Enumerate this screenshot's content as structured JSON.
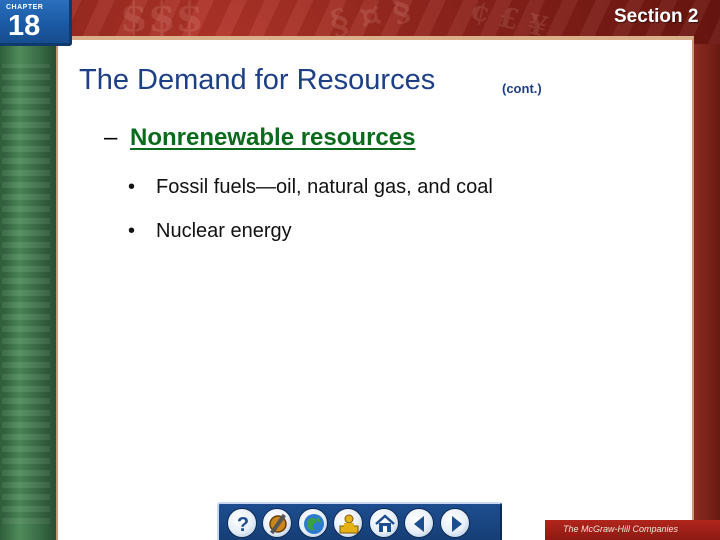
{
  "header": {
    "chapter_label": "CHAPTER",
    "chapter_number": "18",
    "section_label": "Section 2"
  },
  "slide": {
    "title": "The Demand for Resources",
    "title_suffix": "(cont.)",
    "subheading_dash": "–",
    "subheading": "Nonrenewable resources",
    "bullets": [
      "Fossil fuels—oil, natural gas, and coal",
      "Nuclear energy"
    ],
    "bullet_symbol": "•"
  },
  "nav": {
    "buttons": [
      {
        "name": "help-button",
        "icon": "question-icon"
      },
      {
        "name": "resources-button",
        "icon": "tools-icon"
      },
      {
        "name": "web-button",
        "icon": "globe-icon"
      },
      {
        "name": "presentation-button",
        "icon": "presenter-icon"
      },
      {
        "name": "home-button",
        "icon": "home-icon"
      },
      {
        "name": "previous-button",
        "icon": "arrow-left-icon"
      },
      {
        "name": "next-button",
        "icon": "arrow-right-icon"
      }
    ]
  },
  "footer": {
    "publisher": "The McGraw-Hill Companies"
  },
  "colors": {
    "title": "#1d3f86",
    "subheading": "#0b6b1d",
    "chapter_tab": "#1b5aa5",
    "background": "#8d231b",
    "nav_bar": "#1d4d8f"
  }
}
